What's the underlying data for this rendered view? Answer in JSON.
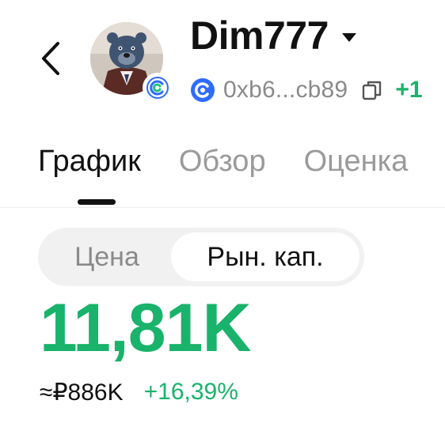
{
  "token": {
    "name": "Dim777",
    "address": "0xb6...cb89",
    "change_fragment": "+1",
    "avatar_icon": "bear-avatar",
    "chain_icon": "chain-logo-icon"
  },
  "tabs": [
    {
      "label": "График",
      "active": true
    },
    {
      "label": "Обзор",
      "active": false
    },
    {
      "label": "Оценка",
      "active": false
    }
  ],
  "segment": {
    "price_label": "Цена",
    "market_cap_label": "Рын. кап.",
    "selected": "market_cap"
  },
  "value": {
    "main": "11,81K",
    "fiat": "≈₽886K",
    "change": "+16,39%"
  },
  "colors": {
    "positive": "#19b36b",
    "muted": "#8a8a8a",
    "text": "#111111"
  }
}
